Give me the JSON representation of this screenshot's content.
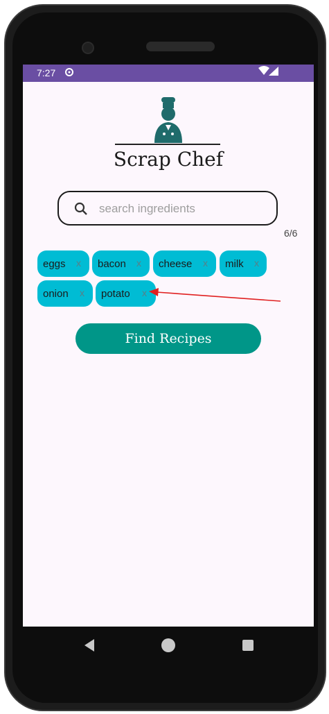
{
  "status": {
    "time": "7:27"
  },
  "app": {
    "title": "Scrap Chef"
  },
  "search": {
    "placeholder": "search ingredients",
    "value": ""
  },
  "counter": "6/6",
  "chips": [
    {
      "label": "eggs",
      "remove": "x"
    },
    {
      "label": "bacon",
      "remove": "x"
    },
    {
      "label": "cheese",
      "remove": "x"
    },
    {
      "label": "milk",
      "remove": "x"
    },
    {
      "label": "onion",
      "remove": "x"
    },
    {
      "label": "potato",
      "remove": "x"
    }
  ],
  "actions": {
    "find_label": "Find Recipes"
  },
  "colors": {
    "status_bar": "#6a4ea3",
    "chip": "#00bcd4",
    "primary_button": "#009688",
    "logo": "#1f6b6b",
    "annotation_arrow": "#e02020"
  },
  "icons": {
    "logo": "chef-icon",
    "search": "search-icon",
    "sync": "sync-icon",
    "wifi": "wifi-icon",
    "signal": "signal-icon",
    "nav_back": "back-icon",
    "nav_home": "home-icon",
    "nav_recents": "recents-icon"
  }
}
